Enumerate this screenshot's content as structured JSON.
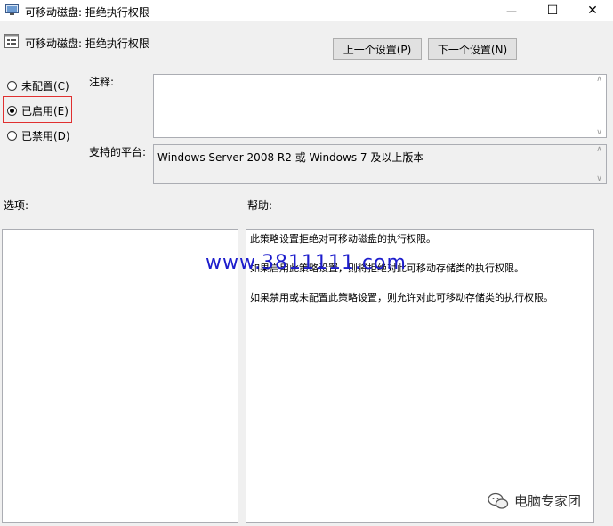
{
  "window": {
    "title": "可移动磁盘: 拒绝执行权限",
    "minimize_glyph": "—",
    "maximize_glyph": "☐",
    "close_glyph": "✕"
  },
  "header": {
    "policy_title": "可移动磁盘: 拒绝执行权限",
    "prev_button": "上一个设置(P)",
    "next_button": "下一个设置(N)"
  },
  "state_options": [
    {
      "label": "未配置(C)",
      "checked": false
    },
    {
      "label": "已启用(E)",
      "checked": true
    },
    {
      "label": "已禁用(D)",
      "checked": false
    }
  ],
  "comment": {
    "label": "注释:",
    "value": ""
  },
  "platform": {
    "label": "支持的平台:",
    "value": "Windows Server 2008 R2 或 Windows 7 及以上版本"
  },
  "options": {
    "label": "选项:"
  },
  "help": {
    "label": "帮助:",
    "paragraphs": [
      "此策略设置拒绝对可移动磁盘的执行权限。",
      "如果启用此策略设置，则将拒绝对此可移动存储类的执行权限。",
      "如果禁用或未配置此策略设置，则允许对此可移动存储类的执行权限。"
    ]
  },
  "watermark": "www.3811111.com",
  "brand": "电脑专家团",
  "colors": {
    "highlight_border": "#e03030",
    "watermark": "#1d1dcc"
  }
}
